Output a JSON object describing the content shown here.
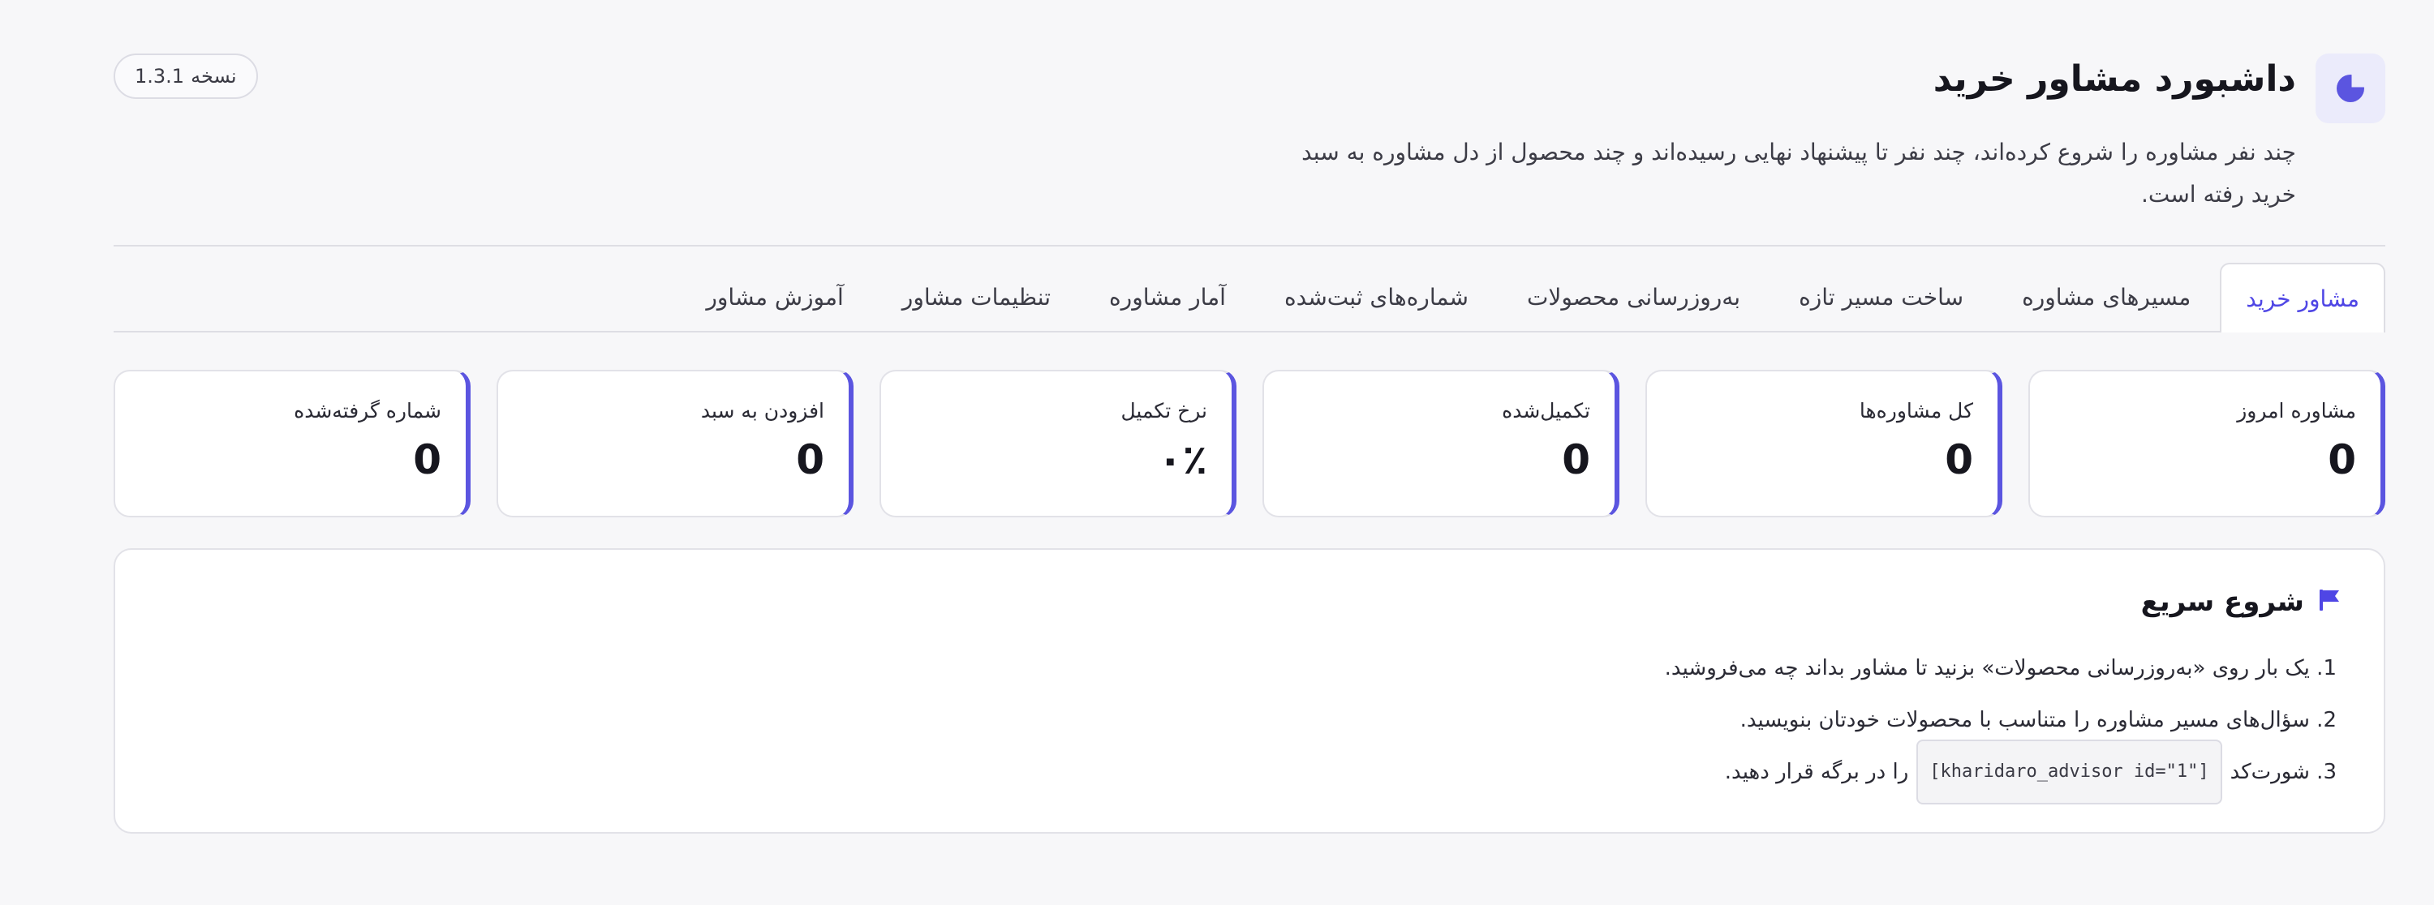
{
  "header": {
    "icon": "pie-chart-icon",
    "title": "داشبورد مشاور خرید",
    "description": "چند نفر مشاوره را شروع کرده‌اند، چند نفر تا پیشنهاد نهایی رسیده‌اند و چند محصول از دل مشاوره به سبد خرید رفته است.",
    "version_label": "نسخه",
    "version": "1.3.1"
  },
  "tabs": [
    {
      "label": "مشاور خرید",
      "active": true
    },
    {
      "label": "مسیرهای مشاوره",
      "active": false
    },
    {
      "label": "ساخت مسیر تازه",
      "active": false
    },
    {
      "label": "به‌روزرسانی محصولات",
      "active": false
    },
    {
      "label": "شماره‌های ثبت‌شده",
      "active": false
    },
    {
      "label": "آمار مشاوره",
      "active": false
    },
    {
      "label": "تنظیمات مشاور",
      "active": false
    },
    {
      "label": "آموزش مشاور",
      "active": false
    }
  ],
  "stats": [
    {
      "label": "مشاوره امروز",
      "value": "0"
    },
    {
      "label": "کل مشاوره‌ها",
      "value": "0"
    },
    {
      "label": "تکمیل‌شده",
      "value": "0"
    },
    {
      "label": "نرخ تکمیل",
      "value": "۰٪"
    },
    {
      "label": "افزودن به سبد",
      "value": "0"
    },
    {
      "label": "شماره گرفته‌شده",
      "value": "0"
    }
  ],
  "quick_start": {
    "icon": "flag-icon",
    "title": "شروع سریع",
    "step1": "1. یک بار روی «به‌روزرسانی محصولات» بزنید تا مشاور بداند چه می‌فروشید.",
    "step2": "2. سؤال‌های مسیر مشاوره را متناسب با محصولات خودتان بنویسید.",
    "step3_prefix": "3. شورت‌کد",
    "step3_code": "[kharidaro_advisor id=\"1\"]",
    "step3_suffix": "را در برگه قرار دهید."
  },
  "colors": {
    "accent": "#4f46e5",
    "card_stripe": "#5b55e0",
    "background": "#f7f7f9"
  }
}
